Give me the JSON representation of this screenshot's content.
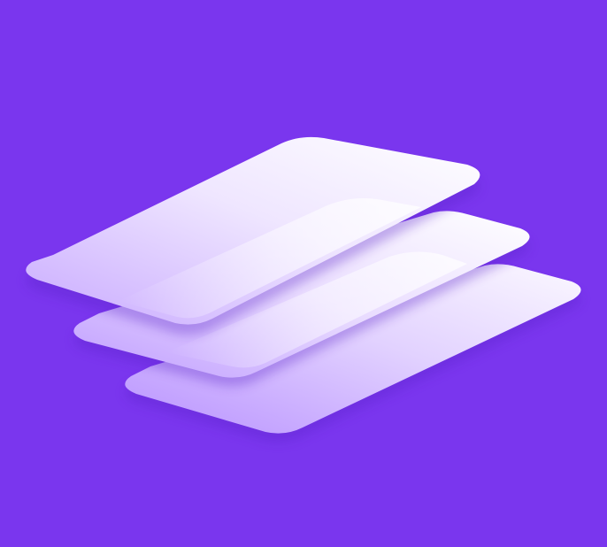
{
  "colors": {
    "background": "#7a36ee",
    "layer_light": "#ffffff",
    "layer_mid": "#e9dcff",
    "layer_shadow": "#5a20c9"
  },
  "logo": {
    "icon": "stacked-layers-icon",
    "layer_count": 3
  }
}
